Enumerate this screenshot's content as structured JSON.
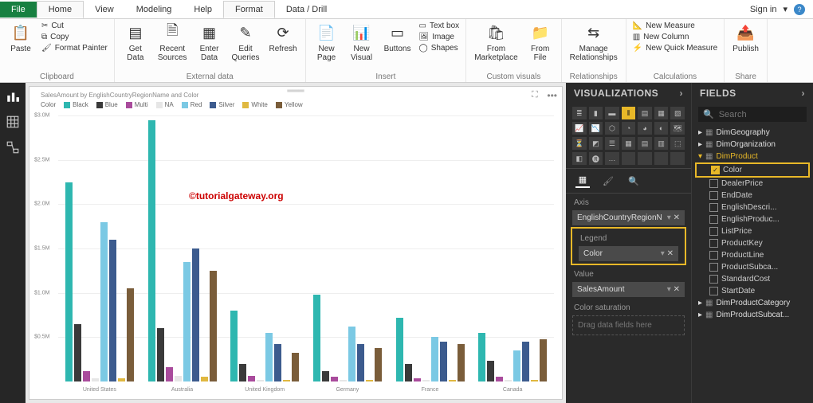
{
  "tabs": [
    "File",
    "Home",
    "View",
    "Modeling",
    "Help",
    "Format",
    "Data / Drill"
  ],
  "top": {
    "signin": "Sign in",
    "dropdown": "▾"
  },
  "ribbon": {
    "clipboard": {
      "paste": "Paste",
      "cut": "Cut",
      "copy": "Copy",
      "fmt": "Format Painter",
      "label": "Clipboard"
    },
    "extdata": {
      "get": "Get\nData",
      "recent": "Recent\nSources",
      "enter": "Enter\nData",
      "edit": "Edit\nQueries",
      "refresh": "Refresh",
      "label": "External data"
    },
    "insert": {
      "newpage": "New\nPage",
      "newvis": "New\nVisual",
      "buttons": "Buttons",
      "textbox": "Text box",
      "image": "Image",
      "shapes": "Shapes",
      "label": "Insert"
    },
    "custom": {
      "market": "From\nMarketplace",
      "file": "From\nFile",
      "label": "Custom visuals"
    },
    "rel": {
      "manage": "Manage\nRelationships",
      "label": "Relationships"
    },
    "calc": {
      "meas": "New Measure",
      "col": "New Column",
      "quick": "New Quick Measure",
      "label": "Calculations"
    },
    "share": {
      "publish": "Publish",
      "label": "Share"
    }
  },
  "chart_data": {
    "type": "bar",
    "title": "SalesAmount by EnglishCountryRegionName and Color",
    "ylabel": "",
    "ylim": [
      0,
      3000000
    ],
    "yticks": [
      "$3.0M",
      "$2.5M",
      "$2.0M",
      "$1.5M",
      "$1.0M",
      "$0.5M"
    ],
    "legend_prefix": "Color",
    "series": [
      {
        "name": "Black",
        "color": "#2eb7b0"
      },
      {
        "name": "Blue",
        "color": "#3a3a3a"
      },
      {
        "name": "Multi",
        "color": "#a94b9c"
      },
      {
        "name": "NA",
        "color": "#e6e6e6"
      },
      {
        "name": "Red",
        "color": "#7bc9e4"
      },
      {
        "name": "Silver",
        "color": "#3c5b8e"
      },
      {
        "name": "White",
        "color": "#e0b840"
      },
      {
        "name": "Yellow",
        "color": "#7a5d3a"
      }
    ],
    "categories": [
      "United States",
      "Australia",
      "United Kingdom",
      "Germany",
      "France",
      "Canada"
    ],
    "data": {
      "United States": [
        2250000,
        650000,
        120000,
        40000,
        1800000,
        1600000,
        40000,
        1050000
      ],
      "Australia": [
        2950000,
        600000,
        160000,
        60000,
        1350000,
        1500000,
        50000,
        1250000
      ],
      "United Kingdom": [
        800000,
        200000,
        60000,
        20000,
        550000,
        420000,
        20000,
        320000
      ],
      "Germany": [
        980000,
        120000,
        50000,
        20000,
        620000,
        420000,
        20000,
        380000
      ],
      "France": [
        720000,
        200000,
        40000,
        20000,
        500000,
        450000,
        20000,
        420000
      ],
      "Canada": [
        550000,
        230000,
        50000,
        20000,
        350000,
        450000,
        20000,
        480000
      ]
    }
  },
  "watermark": "©tutorialgateway.org",
  "viz": {
    "header": "VISUALIZATIONS",
    "wells": {
      "axis_label": "Axis",
      "axis_value": "EnglishCountryRegionN",
      "legend_label": "Legend",
      "legend_value": "Color",
      "value_label": "Value",
      "value_value": "SalesAmount",
      "sat_label": "Color saturation",
      "drop_hint": "Drag data fields here"
    }
  },
  "fields": {
    "header": "FIELDS",
    "search": "Search",
    "tables": [
      "DimGeography",
      "DimOrganization"
    ],
    "expanded": "DimProduct",
    "children": [
      {
        "label": "Color",
        "checked": true,
        "hl": true
      },
      {
        "label": "DealerPrice"
      },
      {
        "label": "EndDate"
      },
      {
        "label": "EnglishDescri..."
      },
      {
        "label": "EnglishProduc..."
      },
      {
        "label": "ListPrice"
      },
      {
        "label": "ProductKey"
      },
      {
        "label": "ProductLine"
      },
      {
        "label": "ProductSubca..."
      },
      {
        "label": "StandardCost"
      },
      {
        "label": "StartDate"
      }
    ],
    "after": [
      "DimProductCategory",
      "DimProductSubcat..."
    ]
  }
}
